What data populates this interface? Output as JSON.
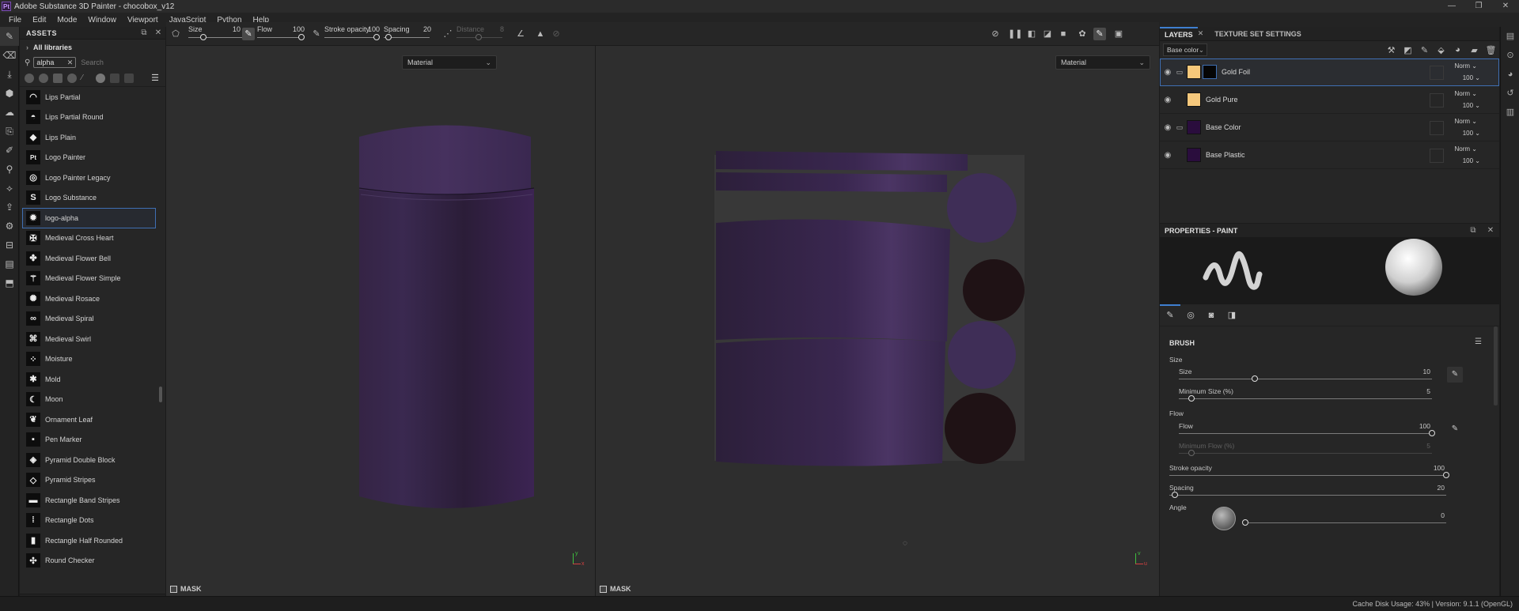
{
  "window": {
    "icon_text": "Pt",
    "title": "Adobe Substance 3D Painter - chocobox_v12",
    "controls": [
      "—",
      "❐",
      "✕"
    ]
  },
  "menu": [
    "File",
    "Edit",
    "Mode",
    "Window",
    "Viewport",
    "JavaScript",
    "Python",
    "Help"
  ],
  "assets": {
    "title": "ASSETS",
    "libraries_label": "All libraries",
    "search_tag": "alpha",
    "search_placeholder": "Search",
    "items": [
      {
        "label": "Lips Partial",
        "glyph": "◠"
      },
      {
        "label": "Lips Partial Round",
        "glyph": "◓"
      },
      {
        "label": "Lips Plain",
        "glyph": "◆"
      },
      {
        "label": "Logo Painter",
        "glyph": "Pt"
      },
      {
        "label": "Logo Painter Legacy",
        "glyph": "◎"
      },
      {
        "label": "Logo Substance",
        "glyph": "S"
      },
      {
        "label": "logo-alpha",
        "glyph": "✹"
      },
      {
        "label": "Medieval Cross Heart",
        "glyph": "✠"
      },
      {
        "label": "Medieval Flower Bell",
        "glyph": "✤"
      },
      {
        "label": "Medieval Flower Simple",
        "glyph": "⚚"
      },
      {
        "label": "Medieval Rosace",
        "glyph": "✺"
      },
      {
        "label": "Medieval Spiral",
        "glyph": "∞"
      },
      {
        "label": "Medieval Swirl",
        "glyph": "⌘"
      },
      {
        "label": "Moisture",
        "glyph": "⁘"
      },
      {
        "label": "Mold",
        "glyph": "✱"
      },
      {
        "label": "Moon",
        "glyph": "☾"
      },
      {
        "label": "Ornament Leaf",
        "glyph": "❦"
      },
      {
        "label": "Pen Marker",
        "glyph": "▪"
      },
      {
        "label": "Pyramid Double Block",
        "glyph": "◈"
      },
      {
        "label": "Pyramid Stripes",
        "glyph": "◇"
      },
      {
        "label": "Rectangle Band Stripes",
        "glyph": "▬"
      },
      {
        "label": "Rectangle Dots",
        "glyph": "⁞"
      },
      {
        "label": "Rectangle Half Rounded",
        "glyph": "▮"
      },
      {
        "label": "Round Checker",
        "glyph": "✣"
      }
    ],
    "selected_index": 6
  },
  "toolbar": {
    "size_label": "Size",
    "size_value": "10",
    "flow_label": "Flow",
    "flow_value": "100",
    "stroke_label": "Stroke opacity",
    "stroke_value": "100",
    "spacing_label": "Spacing",
    "spacing_value": "20",
    "distance_label": "Distance",
    "distance_value": "8"
  },
  "viewport3d": {
    "mode": "Material",
    "mask_label": "MASK",
    "axis_x": "x",
    "axis_y": "y"
  },
  "viewport2d": {
    "mode": "Material",
    "mask_label": "MASK",
    "axis_x": "u",
    "axis_y": "v"
  },
  "layers": {
    "tab_layers": "LAYERS",
    "tab_texture": "TEXTURE SET SETTINGS",
    "channel": "Base color",
    "rows": [
      {
        "name": "Gold Foil",
        "blend": "Norm",
        "opacity": "100",
        "color": "#f7c87a",
        "folder": true,
        "mask": true
      },
      {
        "name": "Gold Pure",
        "blend": "Norm",
        "opacity": "100",
        "color": "#f5c87c",
        "folder": false,
        "mask": false
      },
      {
        "name": "Base Color",
        "blend": "Norm",
        "opacity": "100",
        "color": "#2a0d3d",
        "folder": true,
        "mask": false
      },
      {
        "name": "Base Plastic",
        "blend": "Norm",
        "opacity": "100",
        "color": "#2a0d3d",
        "folder": false,
        "mask": false
      }
    ]
  },
  "properties": {
    "title": "PROPERTIES - PAINT",
    "section": "BRUSH",
    "size_group": "Size",
    "size_label": "Size",
    "size_value": "10",
    "size_frac": 0.3,
    "min_size_label": "Minimum Size (%)",
    "min_size_value": "5",
    "min_size_frac": 0.05,
    "flow_group": "Flow",
    "flow_label": "Flow",
    "flow_value": "100",
    "flow_frac": 1.0,
    "min_flow_label": "Minimum Flow (%)",
    "min_flow_value": "5",
    "min_flow_frac": 0.05,
    "stroke_label": "Stroke opacity",
    "stroke_value": "100",
    "stroke_frac": 1.0,
    "spacing_label": "Spacing",
    "spacing_value": "20",
    "spacing_frac": 0.02,
    "angle_label": "Angle",
    "angle_value": "0",
    "angle_frac": 0.0
  },
  "status": {
    "text": "Cache Disk Usage:   43% | Version: 9.1.1 (OpenGL)"
  },
  "colors": {
    "accent": "#3f6fb3",
    "purple": "#3b2350"
  }
}
